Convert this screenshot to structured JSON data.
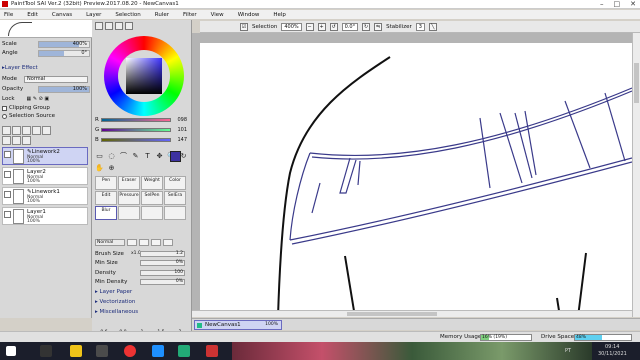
{
  "window": {
    "title": "PaintTool SAI Ver.2 (32bit) Preview.2017.08.20 - NewCanvas1"
  },
  "menu": [
    "File",
    "Edit",
    "Canvas",
    "Layer",
    "Selection",
    "Ruler",
    "Filter",
    "View",
    "Window",
    "Help"
  ],
  "toolbar": {
    "selection_label": "Selection",
    "zoom_value": "400%",
    "rotation_value": "0.0°",
    "stabilizer_label": "Stabilizer",
    "stabilizer_value": "3"
  },
  "navigator": {
    "scale_label": "Scale",
    "scale_value": "400%",
    "scale_fraction": 0.8,
    "angle_label": "Angle",
    "angle_value": "0°",
    "angle_fraction": 0.5
  },
  "layer_panel": {
    "effect_label": "Layer Effect",
    "mode_label": "Mode",
    "mode_value": "Normal",
    "opacity_label": "Opacity",
    "opacity_value": "100%",
    "opacity_fraction": 1.0,
    "lock_label": "Lock",
    "clipping_label": "Clipping Group",
    "selection_source_label": "Selection Source",
    "layers": [
      {
        "name": "Linework2",
        "mode": "Normal",
        "opacity": "100%",
        "selected": true
      },
      {
        "name": "Layer2",
        "mode": "Normal",
        "opacity": "100%",
        "selected": false
      },
      {
        "name": "Linework1",
        "mode": "Normal",
        "opacity": "100%",
        "selected": false
      },
      {
        "name": "Layer1",
        "mode": "Normal",
        "opacity": "100%",
        "selected": false
      }
    ]
  },
  "color": {
    "r_label": "R",
    "r_value": "098",
    "g_label": "G",
    "g_value": "101",
    "b_label": "B",
    "b_value": "147",
    "main_color": "#3d32a0"
  },
  "tools": [
    "▭",
    "◌",
    "⌒",
    "✎",
    "T",
    "✥",
    "🔍",
    "↻",
    "✋",
    "⊕"
  ],
  "brushes": [
    {
      "name": "Pen",
      "active": false
    },
    {
      "name": "Eraser",
      "active": false
    },
    {
      "name": "Weight",
      "active": false
    },
    {
      "name": "Color",
      "active": false
    },
    {
      "name": "Edit",
      "active": false
    },
    {
      "name": "Pressure",
      "active": false
    },
    {
      "name": "SelPen",
      "active": false
    },
    {
      "name": "SelEra",
      "active": false
    },
    {
      "name": "Blur",
      "active": true
    },
    {
      "name": "",
      "active": false
    },
    {
      "name": "",
      "active": false
    },
    {
      "name": "",
      "active": false
    }
  ],
  "brush_settings": {
    "mode_value": "Normal",
    "brush_size_label": "Brush Size",
    "brush_size_mult": "x1.0",
    "brush_size_value": "1.2",
    "min_size_label": "Min Size",
    "min_size_value": "0%",
    "density_label": "Density",
    "density_value": "100",
    "min_density_label": "Min Density",
    "min_density_value": "0%",
    "sections": [
      "Layer Paper",
      "Vectorization",
      "Miscellaneous"
    ],
    "sizes": [
      "0.6",
      "0.8",
      "1",
      "1.5",
      "2"
    ]
  },
  "document": {
    "tab_name": "NewCanvas1",
    "tab_zoom": "100%"
  },
  "status": {
    "memory_label": "Memory Usage",
    "memory_value": "16% (19%)",
    "memory_fraction": 0.16,
    "drive_label": "Drive Space",
    "drive_value": "48%",
    "drive_fraction": 0.48
  },
  "taskbar": {
    "time": "09:14",
    "date": "30/11/2021",
    "lang": "PT"
  },
  "colors": {
    "accent": "#6a6ac0",
    "selected_bg": "#cfd4f3",
    "linework": "#3a3a8a"
  }
}
